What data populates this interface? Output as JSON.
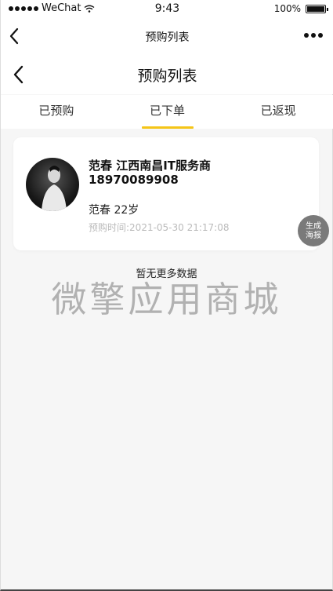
{
  "status_bar": {
    "carrier": "WeChat",
    "time": "9:43",
    "battery": "100%",
    "battery_level": 1.0
  },
  "wx_nav": {
    "title": "预购列表"
  },
  "header": {
    "title": "预购列表"
  },
  "tabs": [
    {
      "label": "已预购",
      "active": false
    },
    {
      "label": "已下单",
      "active": true
    },
    {
      "label": "已返现",
      "active": false
    }
  ],
  "accent_color": "#f5c518",
  "order_card": {
    "name_line": "范春 江西南昌IT服务商",
    "phone": "18970089908",
    "person_line": "范春 22岁",
    "time_line": "预购时间:2021-05-30 21:17:08"
  },
  "poster_button": {
    "label_1": "生成",
    "label_2": "海报"
  },
  "footer": {
    "no_more": "暂无更多数据",
    "watermark": "微擎应用商城"
  }
}
